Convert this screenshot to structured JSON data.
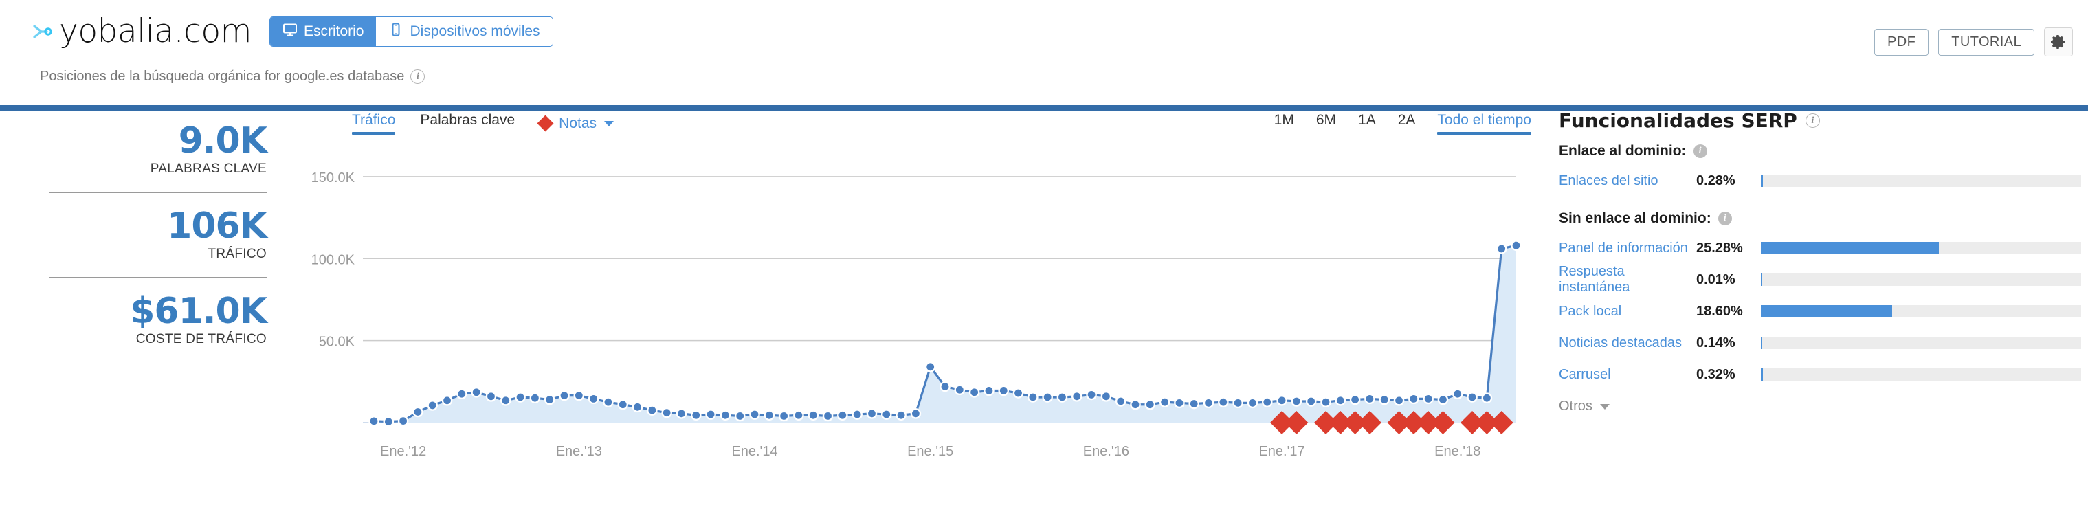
{
  "header": {
    "site_title": "yobalia.com",
    "logo_icon": "yobalia-logo-icon",
    "subtitle": "Posiciones de la búsqueda orgánica for google.es database",
    "subtitle_info_icon": "info-icon",
    "device_toggle": [
      {
        "label": "Escritorio",
        "icon": "desktop-icon",
        "active": true
      },
      {
        "label": "Dispositivos móviles",
        "icon": "mobile-icon",
        "active": false
      }
    ],
    "actions": [
      {
        "label": "PDF",
        "name": "pdf-button"
      },
      {
        "label": "TUTORIAL",
        "name": "tutorial-button"
      }
    ],
    "settings_icon": "gear-icon",
    "accent_color": "#336ca8"
  },
  "metrics": [
    {
      "value": "9.0K",
      "label": "PALABRAS CLAVE"
    },
    {
      "value": "106K",
      "label": "TRÁFICO"
    },
    {
      "value": "$61.0K",
      "label": "COSTE DE TRÁFICO"
    }
  ],
  "chart_panel": {
    "tabs": [
      {
        "label": "Tráfico",
        "active": true
      },
      {
        "label": "Palabras clave",
        "active": false
      }
    ],
    "notes_label": "Notas",
    "notes_icon": "red-diamond-icon",
    "notes_caret_icon": "chevron-down-icon",
    "ranges": [
      {
        "label": "1M",
        "active": false
      },
      {
        "label": "6M",
        "active": false
      },
      {
        "label": "1A",
        "active": false
      },
      {
        "label": "2A",
        "active": false
      },
      {
        "label": "Todo el tiempo",
        "active": true
      }
    ]
  },
  "chart_data": {
    "type": "line",
    "title": "Tráfico",
    "xlabel": "",
    "ylabel": "",
    "grid": true,
    "legend_position": "none",
    "ylim": [
      0,
      160000
    ],
    "yticks": [
      50000,
      100000,
      150000
    ],
    "ytick_labels": [
      "50.0K",
      "100.0K",
      "150.0K"
    ],
    "xticks": [
      "Ene.'12",
      "Ene.'13",
      "Ene.'14",
      "Ene.'15",
      "Ene.'16",
      "Ene.'17",
      "Ene.'18"
    ],
    "series": [
      {
        "name": "Tráfico",
        "color": "#4a7fc1",
        "fill_color": "#dbeaf8",
        "x": [
          "Nov.'11",
          "Dic.'11",
          "Ene.'12",
          "Feb.'12",
          "Mar.'12",
          "Abr.'12",
          "May.'12",
          "Jun.'12",
          "Jul.'12",
          "Ago.'12",
          "Sep.'12",
          "Oct.'12",
          "Nov.'12",
          "Dic.'12",
          "Ene.'13",
          "Feb.'13",
          "Mar.'13",
          "Abr.'13",
          "May.'13",
          "Jun.'13",
          "Jul.'13",
          "Ago.'13",
          "Sep.'13",
          "Oct.'13",
          "Nov.'13",
          "Dic.'13",
          "Ene.'14",
          "Feb.'14",
          "Mar.'14",
          "Abr.'14",
          "May.'14",
          "Jun.'14",
          "Jul.'14",
          "Ago.'14",
          "Sep.'14",
          "Oct.'14",
          "Nov.'14",
          "Dic.'14",
          "Ene.'15",
          "Feb.'15",
          "Mar.'15",
          "Abr.'15",
          "May.'15",
          "Jun.'15",
          "Jul.'15",
          "Ago.'15",
          "Sep.'15",
          "Oct.'15",
          "Nov.'15",
          "Dic.'15",
          "Ene.'16",
          "Feb.'16",
          "Mar.'16",
          "Abr.'16",
          "May.'16",
          "Jun.'16",
          "Jul.'16",
          "Ago.'16",
          "Sep.'16",
          "Oct.'16",
          "Nov.'16",
          "Dic.'16",
          "Ene.'17",
          "Feb.'17",
          "Mar.'17",
          "Abr.'17",
          "May.'17",
          "Jun.'17",
          "Jul.'17",
          "Ago.'17",
          "Sep.'17",
          "Oct.'17",
          "Nov.'17",
          "Dic.'17",
          "Ene.'18",
          "Feb.'18",
          "Mar.'18",
          "Abr.'18",
          "May.'18"
        ],
        "values": [
          900,
          600,
          1000,
          6500,
          10500,
          13500,
          17500,
          18500,
          16000,
          13500,
          15500,
          15000,
          14000,
          16500,
          16500,
          14500,
          12500,
          11000,
          9500,
          7500,
          6000,
          5500,
          4500,
          5000,
          4500,
          4000,
          5000,
          4500,
          4000,
          4500,
          4500,
          4000,
          4500,
          5000,
          5500,
          5000,
          4500,
          5500,
          34000,
          22000,
          20000,
          18500,
          19500,
          19500,
          18000,
          15500,
          15500,
          15500,
          16000,
          17000,
          16000,
          13000,
          11000,
          11000,
          12500,
          12000,
          11500,
          12000,
          12500,
          12000,
          12000,
          12500,
          13500,
          13000,
          13000,
          12500,
          13500,
          14000,
          14500,
          14000,
          13500,
          14500,
          14500,
          14000,
          17500,
          15500,
          15000,
          106000,
          108000
        ]
      }
    ],
    "annotations": {
      "name": "Notas",
      "marker": "red-diamond",
      "color": "#dc3c2e",
      "count": 13,
      "from_x": "Ene.'17",
      "to_x": "Abr.'18",
      "y": 0
    },
    "spike": {
      "label": "Abr.'18",
      "value": 106000
    }
  },
  "serp": {
    "title": "Funcionalidades SERP",
    "title_info_icon": "info-icon",
    "groups": [
      {
        "heading": "Enlace al dominio:",
        "info_icon": "info-icon",
        "rows": [
          {
            "name": "Enlaces del sitio",
            "pct": "0.28%",
            "bar_pct": 0.28
          }
        ]
      },
      {
        "heading": "Sin enlace al dominio:",
        "info_icon": "info-icon",
        "rows": [
          {
            "name": "Panel de información",
            "pct": "25.28%",
            "bar_pct": 25.28
          },
          {
            "name": "Respuesta instantánea",
            "pct": "0.01%",
            "bar_pct": 0.01
          },
          {
            "name": "Pack local",
            "pct": "18.60%",
            "bar_pct": 18.6
          },
          {
            "name": "Noticias destacadas",
            "pct": "0.14%",
            "bar_pct": 0.14
          },
          {
            "name": "Carrusel",
            "pct": "0.32%",
            "bar_pct": 0.32
          }
        ]
      }
    ],
    "more_label": "Otros",
    "more_caret_icon": "chevron-down-icon",
    "bar_color": "#4a90d9",
    "track_color": "#ececec"
  }
}
